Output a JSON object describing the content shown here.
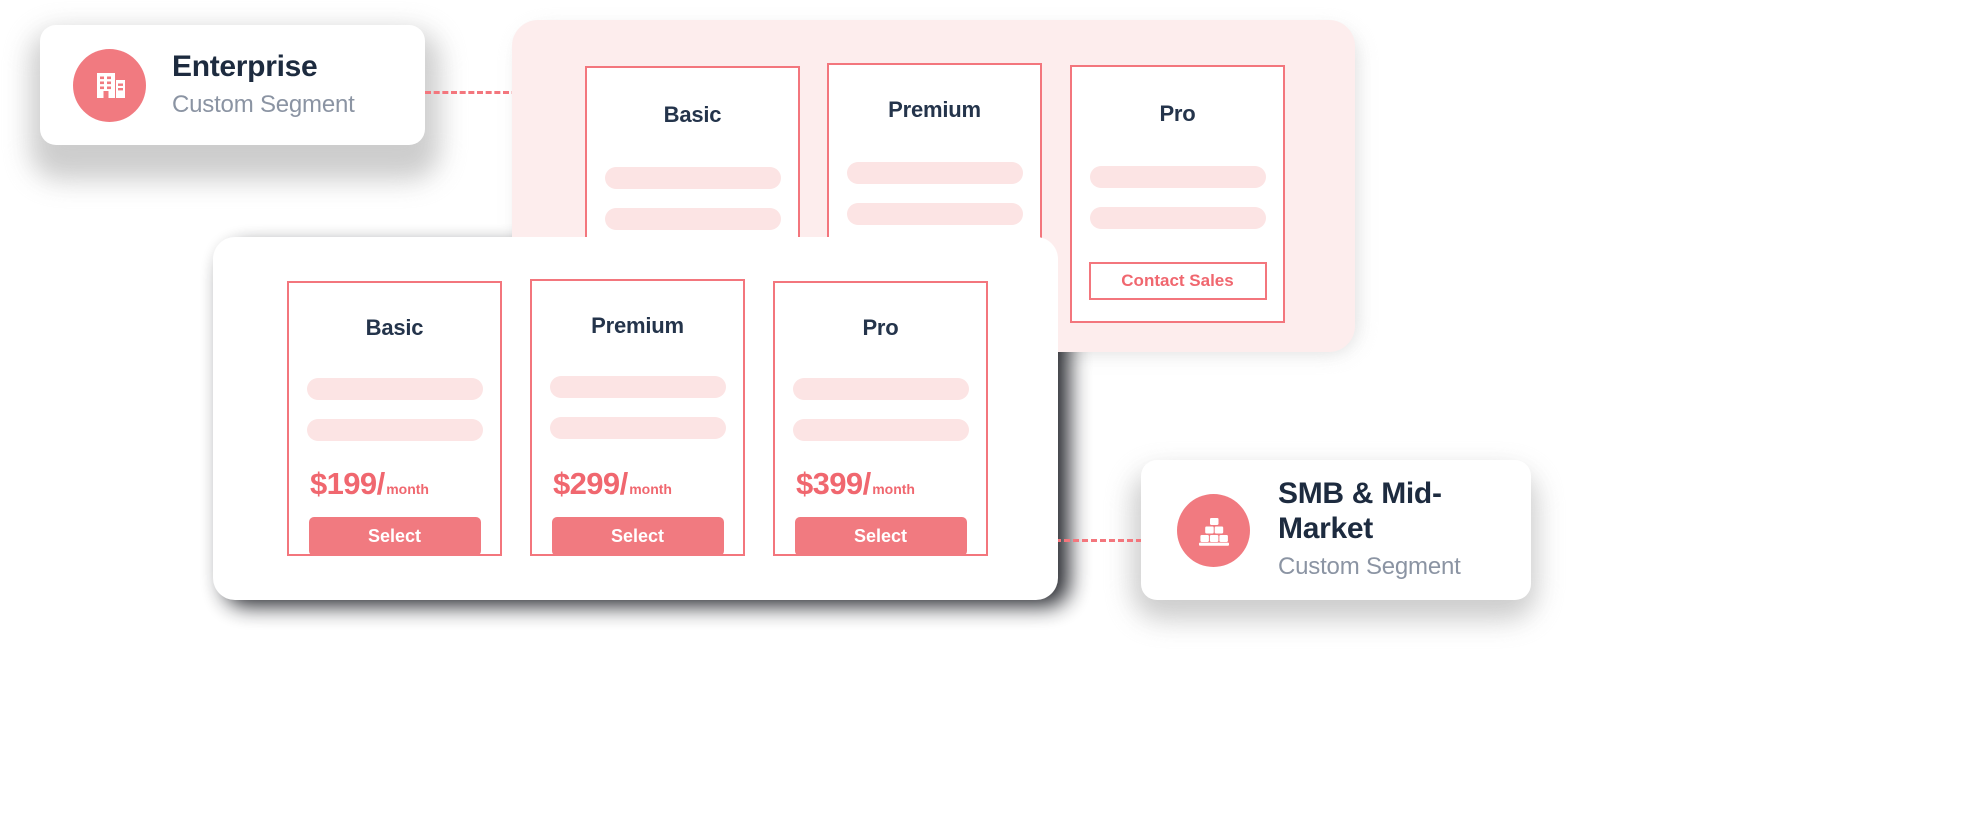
{
  "segments": [
    {
      "id": "enterprise",
      "title": "Enterprise",
      "subtitle": "Custom Segment",
      "icon": "office-building-icon"
    },
    {
      "id": "smb",
      "title": "SMB & Mid-Market",
      "subtitle": "Custom Segment",
      "icon": "brick-pyramid-icon"
    }
  ],
  "back_panel": {
    "tiers": [
      {
        "name": "Basic",
        "placeholder_lines": 2,
        "cta": null
      },
      {
        "name": "Premium",
        "placeholder_lines": 2,
        "cta": null
      },
      {
        "name": "Pro",
        "placeholder_lines": 2,
        "cta": "Contact Sales"
      }
    ]
  },
  "front_panel": {
    "tiers": [
      {
        "name": "Basic",
        "price": "$199",
        "slash": "/",
        "period": "month",
        "cta": "Select"
      },
      {
        "name": "Premium",
        "price": "$299",
        "slash": "/",
        "period": "month",
        "cta": "Select"
      },
      {
        "name": "Pro",
        "price": "$399",
        "slash": "/",
        "period": "month",
        "cta": "Select"
      }
    ]
  },
  "colors": {
    "coral": "#F17A80",
    "coral_border": "#F3767D",
    "coral_text": "#F0676F",
    "pink_panel": "#FDEDED",
    "skeleton": "#FCE4E4",
    "navy": "#24344b",
    "muted": "#8b94a3",
    "white": "#ffffff"
  }
}
